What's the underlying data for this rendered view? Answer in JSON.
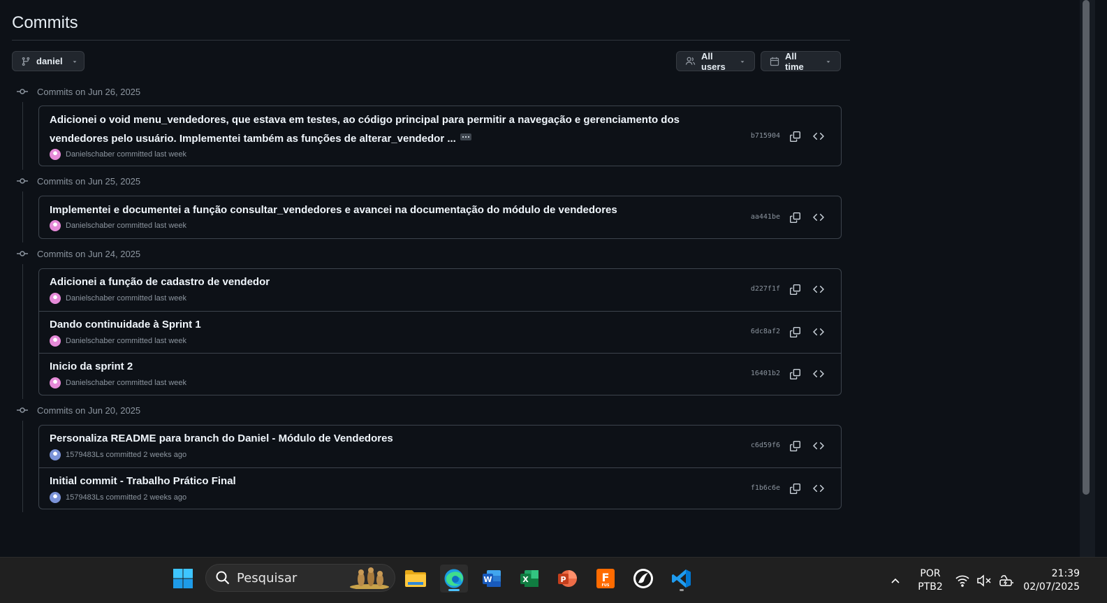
{
  "page": {
    "title": "Commits",
    "branch_label": "daniel",
    "users_filter_label": "All users",
    "time_filter_label": "All time"
  },
  "groups": [
    {
      "label": "Commits on Jun 26, 2025",
      "commits": [
        {
          "message_line1": "Adicionei o void menu_vendedores, que estava em testes, ao código principal para permitir a navegação e gerenciamento dos",
          "message_line2": "vendedores pelo usuário. Implementei também as funções de alterar_vendedor ...",
          "author": "Danielschaber",
          "when": "committed last week",
          "sha": "b715904",
          "avatar": "pink"
        }
      ]
    },
    {
      "label": "Commits on Jun 25, 2025",
      "commits": [
        {
          "message_line1": "Implementei e documentei a função consultar_vendedores e avancei na documentação do módulo de vendedores",
          "author": "Danielschaber",
          "when": "committed last week",
          "sha": "aa441be",
          "avatar": "pink"
        }
      ]
    },
    {
      "label": "Commits on Jun 24, 2025",
      "commits": [
        {
          "message_line1": "Adicionei a função de cadastro de vendedor",
          "author": "Danielschaber",
          "when": "committed last week",
          "sha": "d227f1f",
          "avatar": "pink"
        },
        {
          "message_line1": "Dando continuidade à Sprint 1",
          "author": "Danielschaber",
          "when": "committed last week",
          "sha": "6dc8af2",
          "avatar": "pink"
        },
        {
          "message_line1": "Inicio da sprint 2",
          "author": "Danielschaber",
          "when": "committed last week",
          "sha": "16401b2",
          "avatar": "pink"
        }
      ]
    },
    {
      "label": "Commits on Jun 20, 2025",
      "commits": [
        {
          "message_line1": "Personaliza README para branch do Daniel - Módulo de Vendedores",
          "author": "1579483Ls",
          "when": "committed 2 weeks ago",
          "sha": "c6d59f6",
          "avatar": "blue"
        },
        {
          "message_line1": "Initial commit - Trabalho Prático Final",
          "author": "1579483Ls",
          "when": "committed 2 weeks ago",
          "sha": "f1b6c6e",
          "avatar": "blue"
        }
      ]
    }
  ],
  "icons": {
    "branch": "git-branch-icon",
    "users": "people-icon",
    "time": "calendar-icon",
    "commit": "git-commit-icon",
    "copy": "copy-icon",
    "browse": "code-icon"
  },
  "taskbar": {
    "search_placeholder": "Pesquisar",
    "language_line1": "POR",
    "language_line2": "PTB2",
    "time": "21:39",
    "date": "02/07/2025",
    "apps": [
      "start",
      "file-explorer",
      "edge",
      "word",
      "excel",
      "powerpoint",
      "fusion",
      "inkscape",
      "vscode"
    ]
  },
  "colors": {
    "background": "#0d1117",
    "border": "#3d444d",
    "text_primary": "#f0f6fc",
    "text_muted": "#8d96a0",
    "taskbar": "#202020"
  }
}
